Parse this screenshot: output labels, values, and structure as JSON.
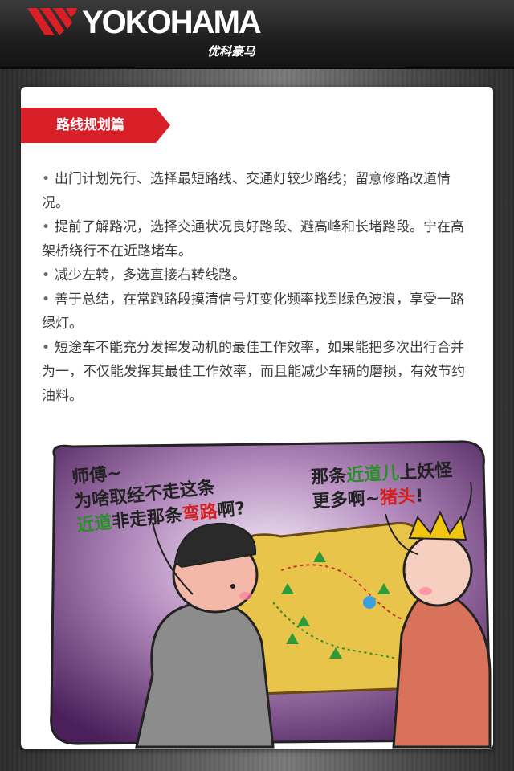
{
  "header": {
    "brand_name": "YOKOHAMA",
    "brand_cn": "优科豪马",
    "logo_icon": "yokohama-stripes-icon"
  },
  "section": {
    "title": "路线规划篇",
    "accent_color": "#d81e27"
  },
  "tips": [
    "出门计划先行、选择最短路线、交通灯较少路线；留意修路改道情况。",
    "提前了解路况，选择交通状况良好路段、避高峰和长堵路段。宁在高架桥绕行不在近路堵车。",
    "减少左转，多选直接右转线路。",
    "善于总结，在常跑路段摸清信号灯变化频率找到绿色波浪，享受一路绿灯。",
    "短途车不能充分发挥发动机的最佳工作效率，如果能把多次出行合并为一，不仅能发挥其最佳工作效率，而且能减少车辆的磨损，有效节约油料。"
  ],
  "comic": {
    "left_line1": "师傅~",
    "left_line2": "为啥取经不走这条",
    "left_line3_green": "近道",
    "left_line3_mid": "非走那条",
    "left_line3_red": "弯路",
    "left_line3_end": "啊?",
    "right_line1_a": "那条",
    "right_line1_green": "近道儿",
    "right_line1_b": "上妖怪",
    "right_line2_a": "更多啊~",
    "right_line2_red": "猪头",
    "right_line2_b": "!",
    "background_color": "#5a2a6a"
  }
}
